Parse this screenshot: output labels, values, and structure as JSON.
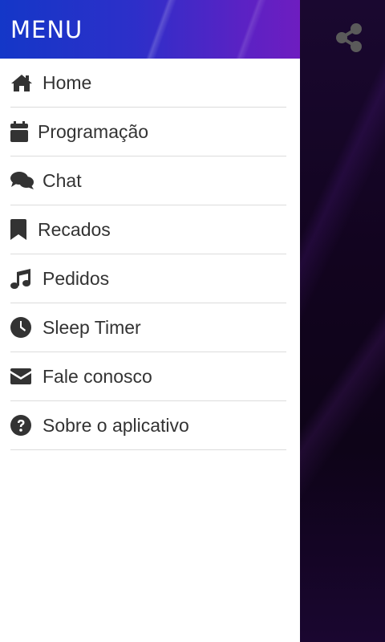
{
  "drawer": {
    "title": "MENU",
    "items": [
      {
        "label": "Home",
        "icon": "home-icon"
      },
      {
        "label": "Programação",
        "icon": "calendar-icon"
      },
      {
        "label": "Chat",
        "icon": "chat-icon"
      },
      {
        "label": "Recados",
        "icon": "bookmark-icon"
      },
      {
        "label": "Pedidos",
        "icon": "music-icon"
      },
      {
        "label": "Sleep Timer",
        "icon": "clock-icon"
      },
      {
        "label": "Fale conosco",
        "icon": "envelope-icon"
      },
      {
        "label": "Sobre o aplicativo",
        "icon": "question-icon"
      }
    ]
  },
  "app": {
    "share_icon": "share-icon"
  },
  "colors": {
    "header_start": "#1437c8",
    "header_end": "#6e1dc0",
    "icon": "#333333",
    "divider": "#dcdcdc",
    "background_dark": "#12041f"
  }
}
